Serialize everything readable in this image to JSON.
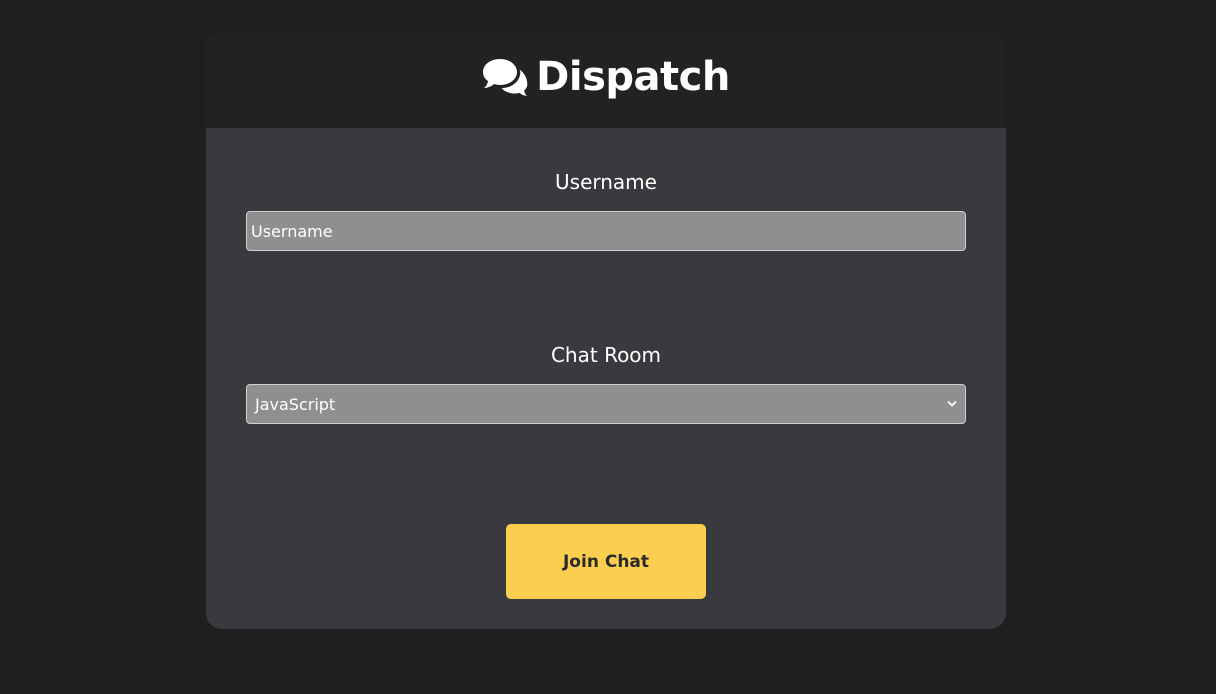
{
  "app": {
    "title": "Dispatch",
    "logo_icon": "comments-icon"
  },
  "form": {
    "username": {
      "label": "Username",
      "placeholder": "Username",
      "value": ""
    },
    "room": {
      "label": "Chat Room",
      "selected": "JavaScript",
      "dropdown_icon": "chevron-down-icon"
    },
    "submit_label": "Join Chat"
  },
  "colors": {
    "page_background": "#201f20",
    "header_background": "#222123",
    "card_background": "#393a3e",
    "input_background": "#8f8f8f",
    "accent": "#fbce50",
    "text": "#ffffff"
  }
}
